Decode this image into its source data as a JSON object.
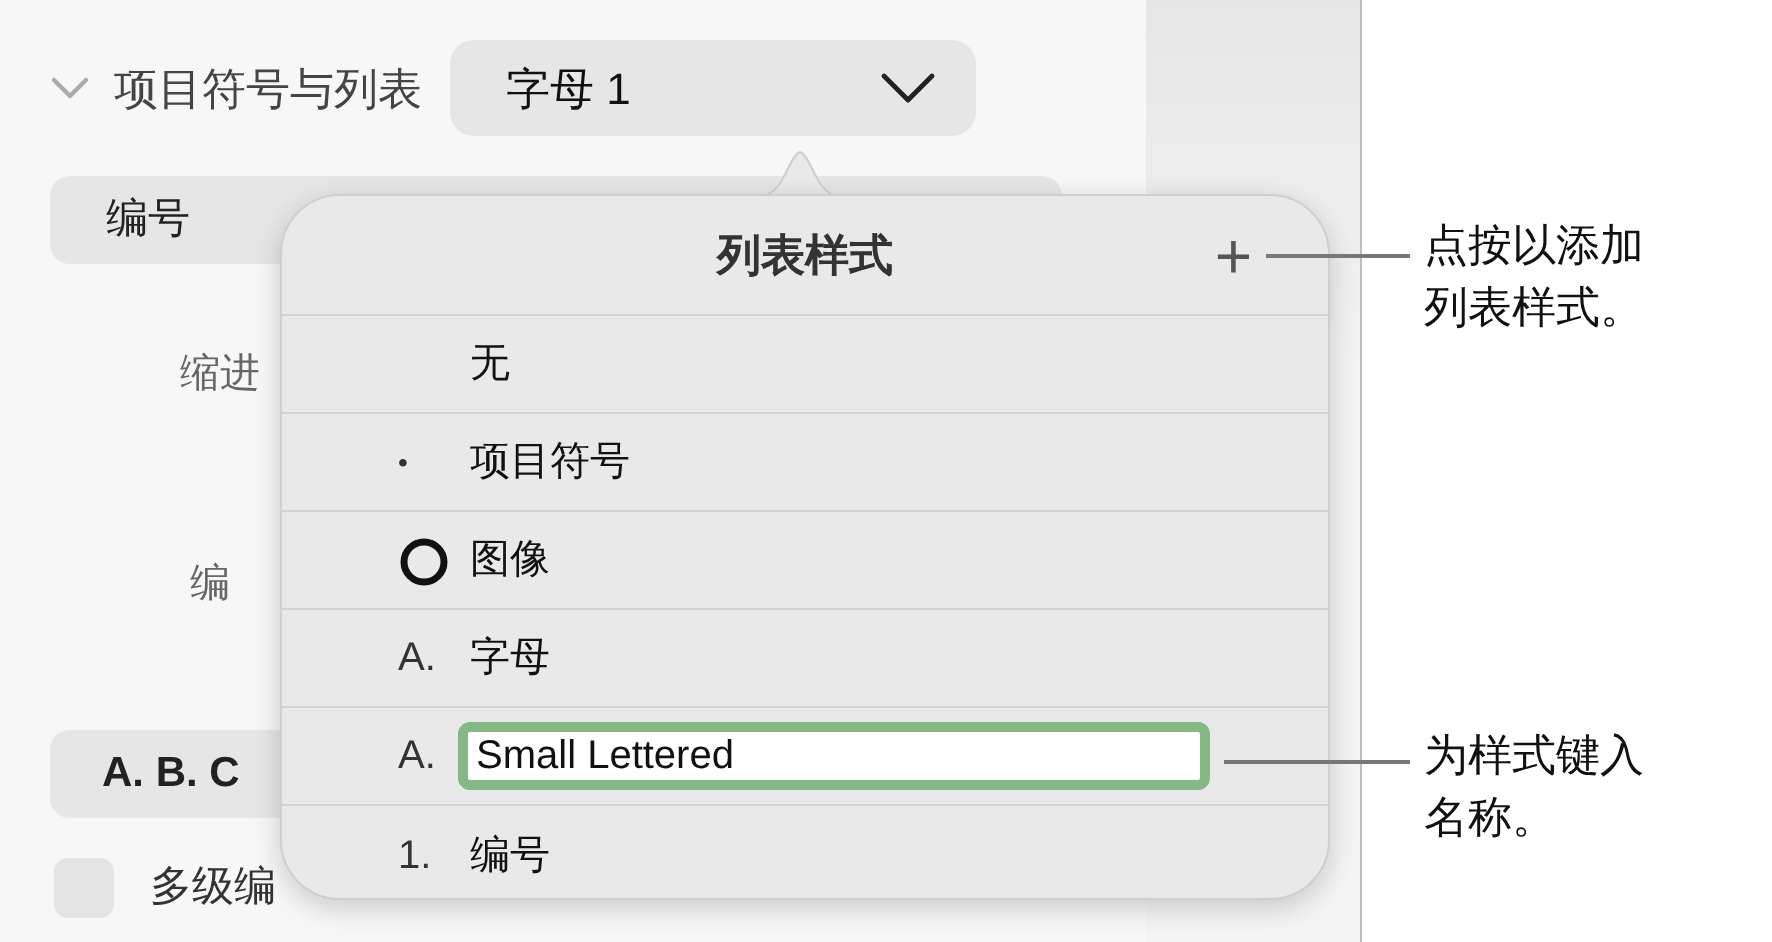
{
  "sidebar": {
    "section": {
      "title": "项目符号与列表",
      "expanded": true,
      "style_popup": "字母 1"
    },
    "list_type_popup": "编号",
    "labels": [
      "缩进",
      "编"
    ],
    "format_popup": "A. B. C",
    "multilevel": {
      "label": "多级编",
      "checked": false
    }
  },
  "popover": {
    "title": "列表样式",
    "add_button": "+",
    "styles": [
      {
        "kind": "text",
        "label": "无",
        "editing": false
      },
      {
        "kind": "text",
        "marker": "•",
        "label": "项目符号",
        "editing": false
      },
      {
        "kind": "image",
        "label": "图像",
        "editing": false
      },
      {
        "kind": "text",
        "marker": "A.",
        "label": "字母",
        "editing": false
      },
      {
        "kind": "text",
        "marker": "A.",
        "label": "Small Lettered",
        "editing": true
      },
      {
        "kind": "text",
        "marker": "1.",
        "label": "编号",
        "editing": false
      }
    ]
  },
  "callouts": [
    "点按以添加列表样式。",
    "为样式键入名称。"
  ]
}
